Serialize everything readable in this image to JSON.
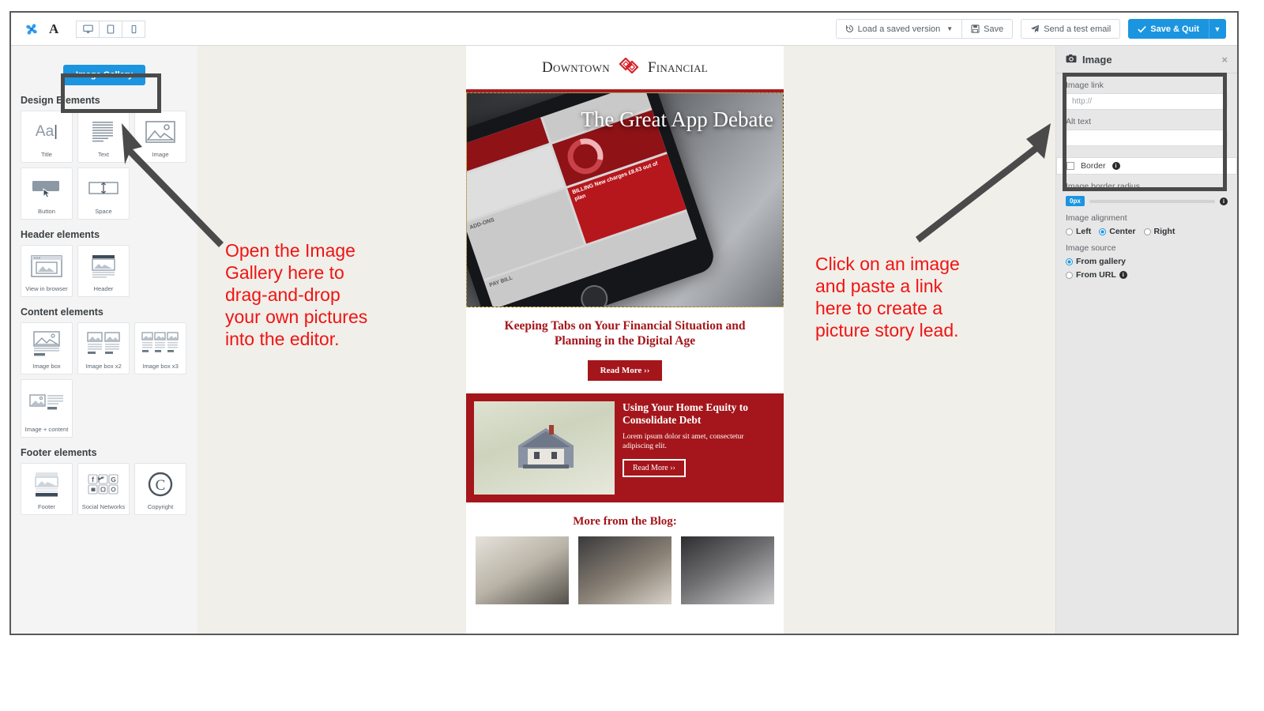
{
  "toolbar": {
    "logo_icon": "pinwheel-logo-icon",
    "font_icon": "letter-a-icon",
    "devices": [
      {
        "name": "desktop",
        "icon": "desktop-icon"
      },
      {
        "name": "tablet",
        "icon": "tablet-icon"
      },
      {
        "name": "mobile",
        "icon": "mobile-icon"
      }
    ],
    "load_version_label": "Load a saved version",
    "save_label": "Save",
    "send_test_label": "Send a test email",
    "save_quit_label": "Save & Quit"
  },
  "sidebar": {
    "gallery_button": "Image Gallery",
    "sections": [
      {
        "title": "Design Elements",
        "tiles": [
          {
            "label": "Title",
            "icon": "title-aa-icon"
          },
          {
            "label": "Text",
            "icon": "text-lines-icon"
          },
          {
            "label": "Image",
            "icon": "image-placeholder-icon"
          },
          {
            "label": "Button",
            "icon": "button-cursor-icon"
          },
          {
            "label": "Space",
            "icon": "vertical-space-icon"
          }
        ]
      },
      {
        "title": "Header elements",
        "tiles": [
          {
            "label": "View in browser",
            "icon": "browser-window-icon"
          },
          {
            "label": "Header",
            "icon": "header-block-icon"
          }
        ]
      },
      {
        "title": "Content elements",
        "tiles": [
          {
            "label": "Image box",
            "icon": "image-box-icon"
          },
          {
            "label": "Image box x2",
            "icon": "image-box-x2-icon"
          },
          {
            "label": "Image box x3",
            "icon": "image-box-x3-icon"
          },
          {
            "label": "Image + content",
            "icon": "image-plus-content-icon"
          }
        ]
      },
      {
        "title": "Footer elements",
        "tiles": [
          {
            "label": "Footer",
            "icon": "footer-block-icon"
          },
          {
            "label": "Social Networks",
            "icon": "social-networks-icon"
          },
          {
            "label": "Copyright",
            "icon": "copyright-icon"
          }
        ]
      }
    ]
  },
  "email": {
    "brand_first": "Downtown",
    "brand_second": "Financial",
    "brand_logo_icon": "diamond-knot-logo-icon",
    "hero_title": "The Great\nApp Debate",
    "hero_tiles": [
      "BILLING\nNew charges\n£8.63\nout of plan",
      "ADD-ONS",
      "PAY\nBILL"
    ],
    "headline": "Keeping Tabs on Your Financial Situation and Planning in the Digital Age",
    "read_more": "Read More ››",
    "promo_title": "Using Your Home Equity to Consolidate Debt",
    "promo_body": "Lorem ipsum dolor sit amet, consectetur adipiscing elit.",
    "promo_button": "Read More ››",
    "blog_heading": "More from the Blog:"
  },
  "properties": {
    "panel_title": "Image",
    "panel_icon": "camera-icon",
    "close_icon": "close-icon",
    "image_link_label": "Image link",
    "image_link_placeholder": "http://",
    "image_link_value": "",
    "alt_text_label": "Alt text",
    "alt_text_value": "",
    "border_label": "Border",
    "border_checked": false,
    "border_radius_label": "Image border radius",
    "border_radius_value": "0px",
    "alignment_label": "Image alignment",
    "alignment_options": [
      "Left",
      "Center",
      "Right"
    ],
    "alignment_selected": "Center",
    "source_label": "Image source",
    "source_options": [
      "From gallery",
      "From URL"
    ],
    "source_selected": "From gallery"
  },
  "annotations": {
    "left_text": "Open the Image\nGallery here to\ndrag-and-drop\nyour own pictures\ninto the editor.",
    "right_text": "Click on an image\nand paste a link\nhere to create a\npicture story lead.",
    "color": "#f01414",
    "highlight_color": "#4a4a4a"
  }
}
